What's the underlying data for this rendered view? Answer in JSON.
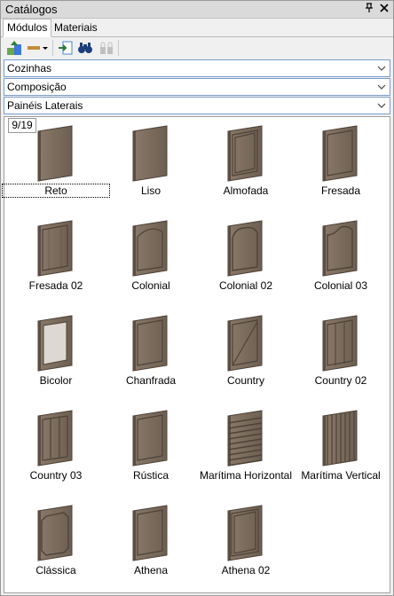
{
  "window": {
    "title": "Catálogos"
  },
  "tabs": [
    {
      "label": "Módulos",
      "active": true
    },
    {
      "label": "Materiais",
      "active": false
    }
  ],
  "toolbar": {
    "icons": [
      "load-catalog-icon",
      "insert-options-icon",
      "import-icon",
      "search-binoculars-icon",
      "disabled-locks-icon"
    ]
  },
  "selectors": [
    {
      "label": "Cozinhas"
    },
    {
      "label": "Composição"
    },
    {
      "label": "Painéis Laterais"
    }
  ],
  "grid": {
    "pager": "9/19",
    "items": [
      {
        "label": "Reto",
        "style": "plain",
        "selected": true
      },
      {
        "label": "Liso",
        "style": "plain",
        "selected": false
      },
      {
        "label": "Almofada",
        "style": "raised",
        "selected": false
      },
      {
        "label": "Fresada",
        "style": "frame",
        "selected": false
      },
      {
        "label": "Fresada 02",
        "style": "groove",
        "selected": false
      },
      {
        "label": "Colonial",
        "style": "arch",
        "selected": false
      },
      {
        "label": "Colonial 02",
        "style": "arch2",
        "selected": false
      },
      {
        "label": "Colonial 03",
        "style": "arch3",
        "selected": false
      },
      {
        "label": "Bicolor",
        "style": "glass",
        "selected": false
      },
      {
        "label": "Chanfrada",
        "style": "frame",
        "selected": false
      },
      {
        "label": "Country",
        "style": "cross",
        "selected": false
      },
      {
        "label": "Country 02",
        "style": "vlines",
        "selected": false
      },
      {
        "label": "Country 03",
        "style": "vlines2",
        "selected": false
      },
      {
        "label": "Rústica",
        "style": "frame",
        "selected": false
      },
      {
        "label": "Marítima Horizontal",
        "style": "hslats",
        "selected": false
      },
      {
        "label": "Marítima Vertical",
        "style": "vslats",
        "selected": false
      },
      {
        "label": "Clássica",
        "style": "octo",
        "selected": false
      },
      {
        "label": "Athena",
        "style": "frame",
        "selected": false
      },
      {
        "label": "Athena 02",
        "style": "frame2",
        "selected": false
      }
    ]
  },
  "colors": {
    "wood": "#7b6c5d",
    "wood_dark": "#4e4238",
    "accent_border": "#7a9ccc"
  }
}
